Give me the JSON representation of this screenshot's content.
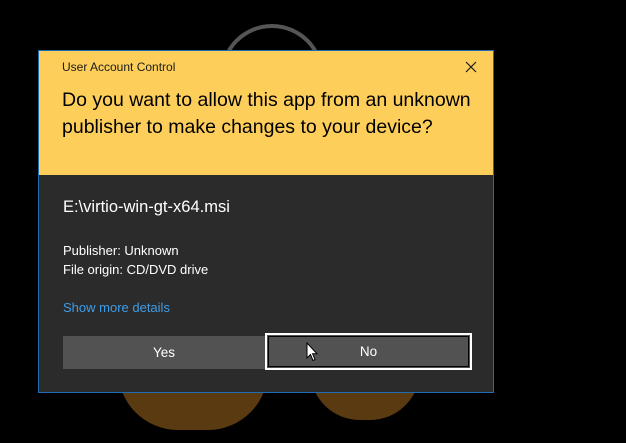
{
  "dialog": {
    "title": "User Account Control",
    "question": "Do you want to allow this app from an unknown publisher to make changes to your device?",
    "filename": "E:\\virtio-win-gt-x64.msi",
    "publisher": "Publisher: Unknown",
    "file_origin": "File origin: CD/DVD drive",
    "more_details": "Show more details",
    "yes_label": "Yes",
    "no_label": "No",
    "close_icon": "close-icon"
  },
  "colors": {
    "header": "#fdcf5a",
    "body": "#2b2b2b",
    "border": "#1f6cb5",
    "link": "#3d9de8",
    "button": "#525252"
  }
}
